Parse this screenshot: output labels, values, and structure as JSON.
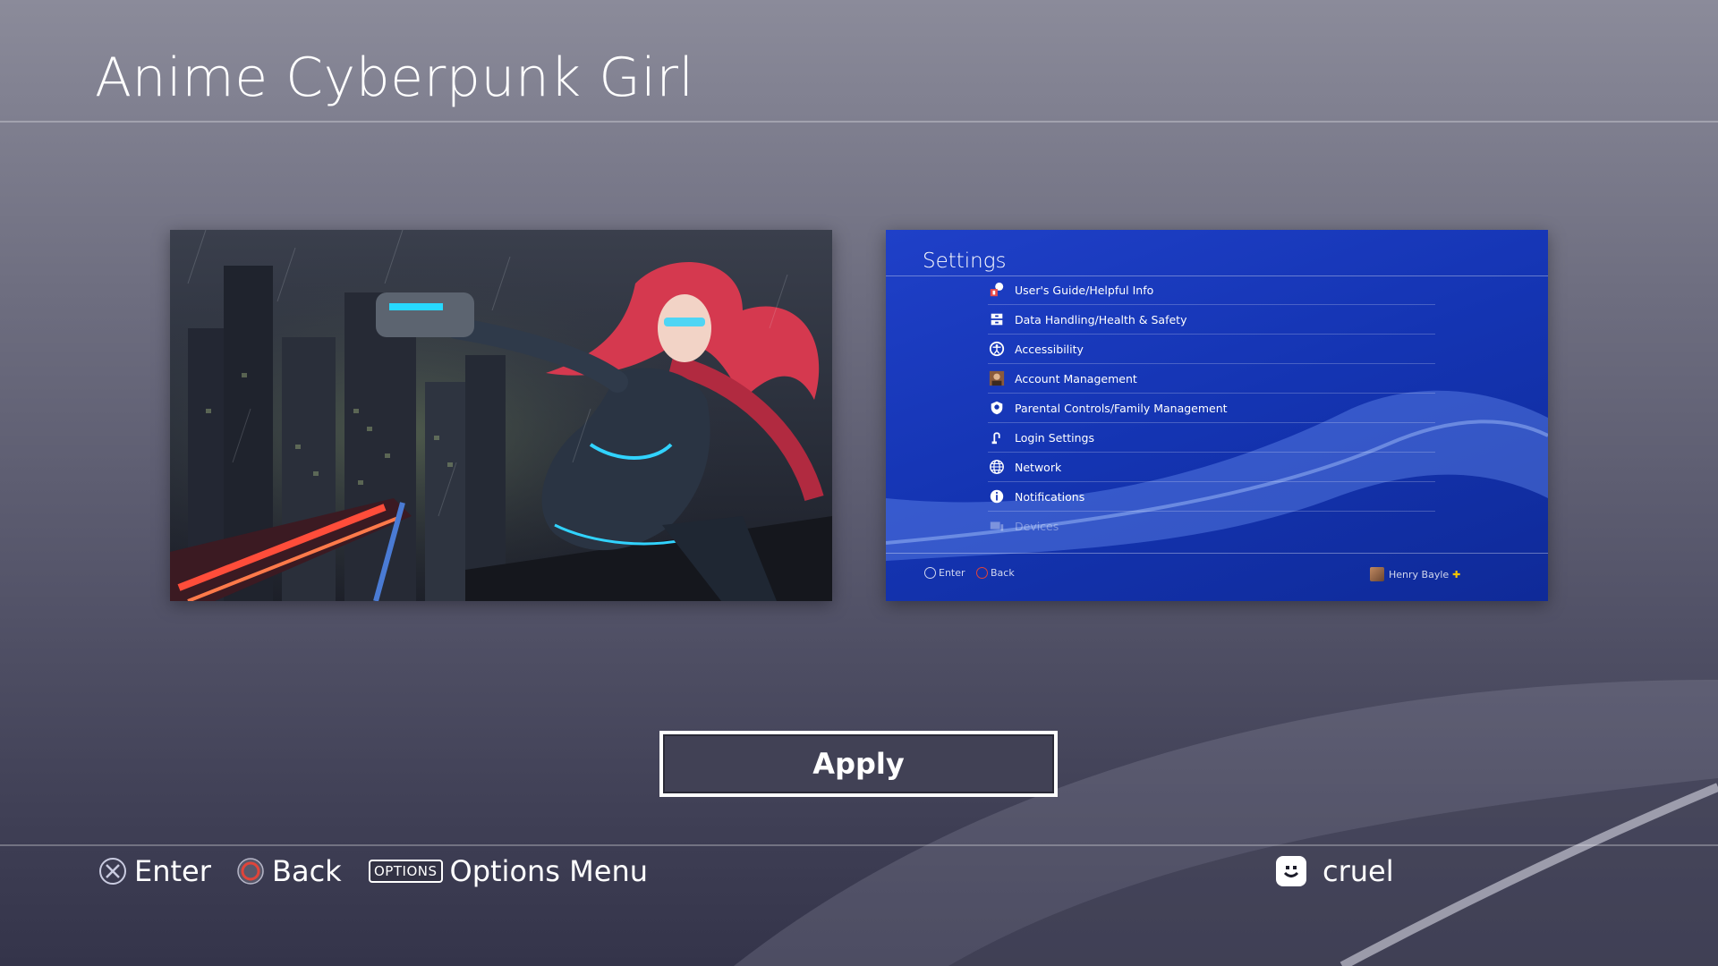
{
  "page": {
    "title": "Anime Cyberpunk Girl"
  },
  "preview": {
    "settings": {
      "title": "Settings",
      "items": [
        {
          "label": "User's Guide/Helpful Info",
          "icon": "help-info-icon"
        },
        {
          "label": "Data Handling/Health & Safety",
          "icon": "data-handling-icon"
        },
        {
          "label": "Accessibility",
          "icon": "accessibility-icon"
        },
        {
          "label": "Account Management",
          "icon": "account-avatar-icon"
        },
        {
          "label": "Parental Controls/Family Management",
          "icon": "parental-controls-icon"
        },
        {
          "label": "Login Settings",
          "icon": "login-icon"
        },
        {
          "label": "Network",
          "icon": "globe-icon"
        },
        {
          "label": "Notifications",
          "icon": "info-icon"
        },
        {
          "label": "Devices",
          "icon": "devices-icon"
        }
      ],
      "footer": {
        "enter": "Enter",
        "back": "Back",
        "user": "Henry Bayle"
      }
    }
  },
  "actions": {
    "apply_label": "Apply"
  },
  "footer": {
    "enter_label": "Enter",
    "back_label": "Back",
    "options_glyph": "OPTIONS",
    "options_label": "Options Menu",
    "username": "cruel"
  },
  "colors": {
    "accent_blue": "#1434b2",
    "circle_button": "#e0443a",
    "cross_button": "#c9cbe0"
  }
}
